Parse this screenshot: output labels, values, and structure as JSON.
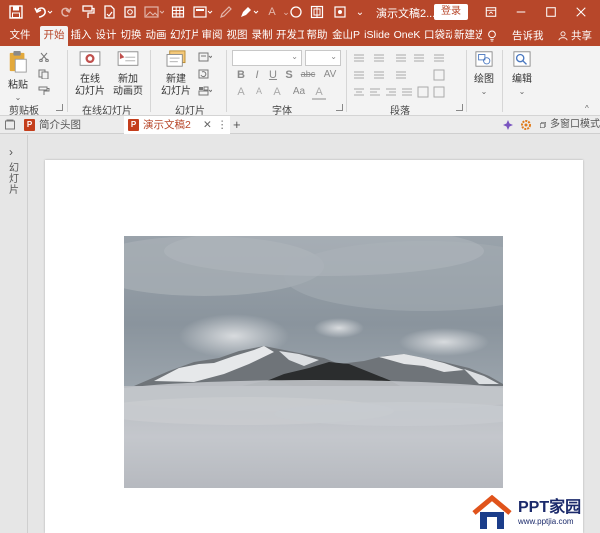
{
  "titlebar": {
    "document_title": "演示文稿2...",
    "login_label": "登录",
    "quick_access": [
      "save-icon",
      "undo-icon",
      "redo-icon",
      "format-painter-icon",
      "new-document-icon",
      "print-preview-icon",
      "image-icon",
      "table-icon",
      "slide-layout-icon",
      "pen-icon",
      "highlighter-icon",
      "font-color-icon",
      "shape-icon",
      "arrange-icon",
      "quick-access-more-icon"
    ],
    "window_buttons": [
      "restore-ribbon-icon",
      "minimize-icon",
      "maximize-icon",
      "close-icon"
    ]
  },
  "tabs": {
    "items": [
      "文件",
      "开始",
      "插入",
      "设计",
      "切换",
      "动画",
      "幻灯片",
      "审阅",
      "视图",
      "录制",
      "开发工",
      "帮助",
      "金山P",
      "iSlide",
      "OneK",
      "口袋动",
      "新建选"
    ],
    "active_index": 1,
    "tell_me": "告诉我",
    "share": "共享"
  },
  "ribbon": {
    "clipboard": {
      "paste": "粘贴",
      "label": "剪贴板"
    },
    "online_slides": {
      "online": "在线\n幻灯片",
      "new_anim": "新加\n动画页",
      "label": "在线幻灯片"
    },
    "slides": {
      "new_slide": "新建\n幻灯片",
      "label": "幻灯片"
    },
    "font": {
      "label": "字体",
      "font_name": "",
      "font_size": "",
      "bold": "B",
      "italic": "I",
      "underline": "U",
      "strikethrough": "S",
      "shadow": "abc",
      "grow": "A",
      "shrink": "A",
      "clear": "A",
      "font_color": "A",
      "spacing": "AV",
      "case": "Aa"
    },
    "paragraph": {
      "label": "段落"
    },
    "drawing": {
      "label": "绘图"
    },
    "editing": {
      "label": "编辑"
    }
  },
  "document_tabs": {
    "items": [
      {
        "title": "简介头图"
      },
      {
        "title": "演示文稿2"
      }
    ],
    "new_tab": "+",
    "multi_window": "多窗口模式"
  },
  "left_panel": {
    "toggle": "›",
    "label": "幻灯片"
  },
  "watermark": {
    "brand": "PPT家园",
    "url": "www.pptjia.com"
  },
  "colors": {
    "accent": "#b7472a",
    "ribbon_bg": "#f3f3f3",
    "workspace_bg": "#e6e6e6"
  }
}
